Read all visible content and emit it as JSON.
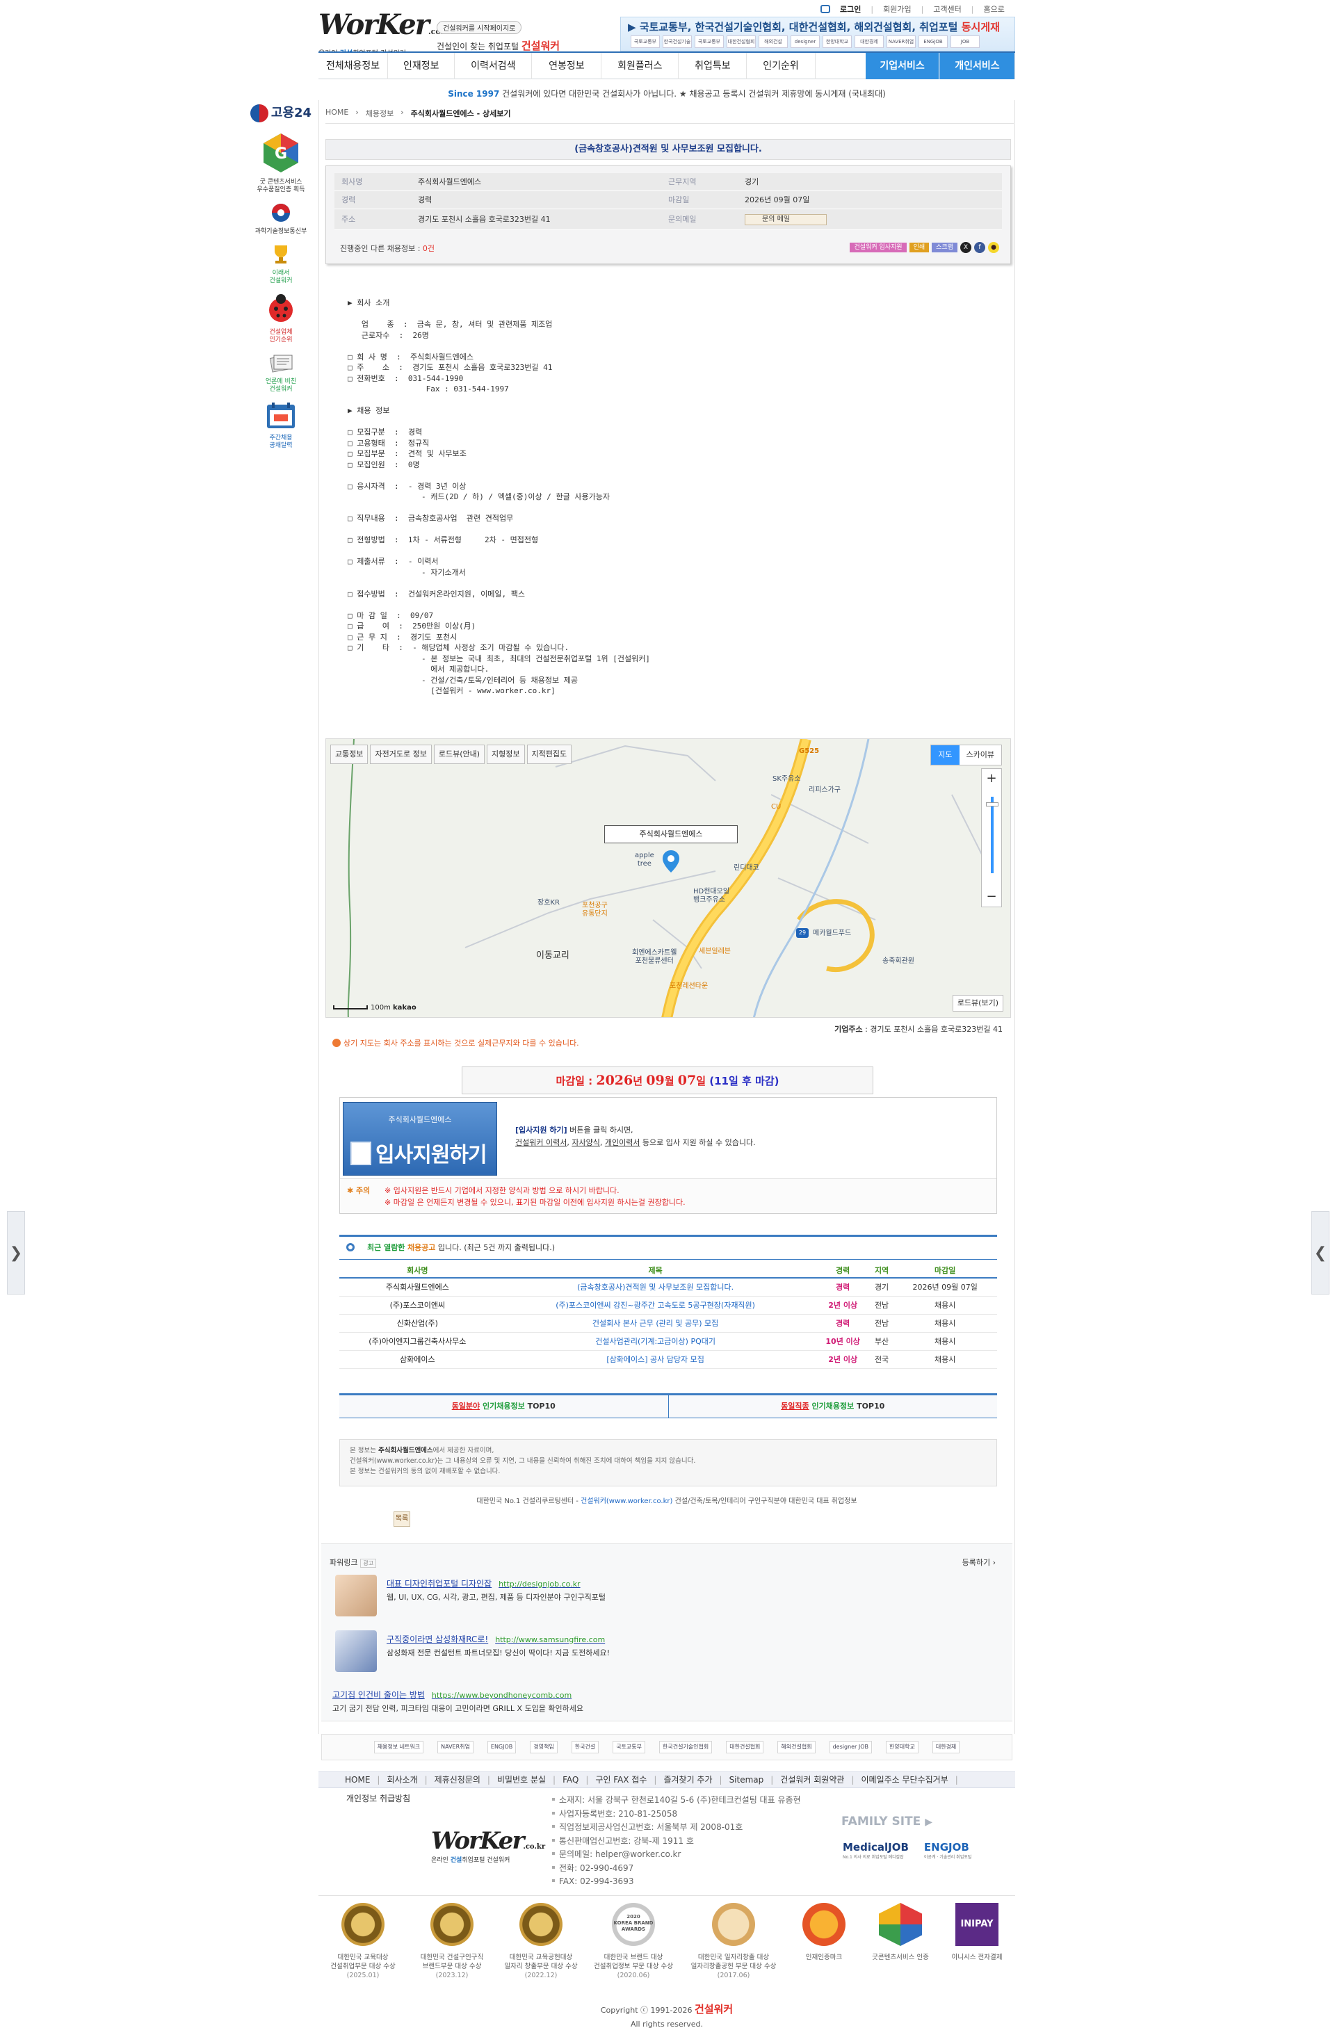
{
  "nav_arrows": {
    "left": "❯",
    "right": "❮"
  },
  "top_links": {
    "login": "로그인",
    "join": "회원가입",
    "support": "고객센터",
    "home": "홈으로"
  },
  "logo": {
    "brand": "WorKer",
    "domain": ".co.kr",
    "tag_pre": "온라인 ",
    "tag_blue": "건설",
    "tag_post": "취업포털 건설워커"
  },
  "slogan": {
    "pill": "건설워커를 시작페이지로",
    "line": "건설인이 찾는 취업포털 ",
    "brand": "건설워커"
  },
  "partner_banner": {
    "text": "국토교통부, 한국건설기술인협회, 대한건설협회, 해외건설협회, 취업포털 ",
    "highlight": "동시게재",
    "logos": [
      "국토교통부",
      "한국건설기술인협회",
      "국토교통부",
      "대한건설협회",
      "해외건설",
      "designer JOB",
      "한양대학교",
      "대한경제",
      "NAVER취업",
      "ENGJOB",
      "JOB"
    ]
  },
  "nav": {
    "items": [
      "전체채용정보",
      "인재정보",
      "이력서검색",
      "연봉정보",
      "회원플러스",
      "취업특보",
      "인기순위"
    ],
    "right_items": [
      "기업서비스",
      "개인서비스"
    ]
  },
  "notice": {
    "since": "Since 1997",
    "text": " 건설워커에 있다면 대한민국 건설회사가 아닙니다. ★ 채용공고 등록시 건설워커 제휴망에 동시게재 (국내최대)"
  },
  "left_bar": {
    "goyong": "고용24",
    "items": [
      {
        "label": "굿 콘텐츠서비스\n우수품질인증 획득",
        "color": ""
      },
      {
        "label": "과학기술정보통신부",
        "color": ""
      },
      {
        "label": "이래서\n건설워커",
        "color": "g"
      },
      {
        "label": "건설업체\n인기순위",
        "color": "r"
      },
      {
        "label": "언론에 비친\n건설워커",
        "color": "g"
      },
      {
        "label": "주간채용\n공채달력",
        "color": "b"
      }
    ]
  },
  "breadcrumb": {
    "home": "HOME",
    "section": "채용정보",
    "current": "주식회사월드엔에스 - 상세보기"
  },
  "job": {
    "title": "(금속창호공사)견적원 및 사무보조원 모집합니다.",
    "company_label": "회사명",
    "company": "주식회사월드엔에스",
    "location_label": "근무지역",
    "location": "경기",
    "career_label": "경력",
    "career": "경력",
    "deadline_label": "마감일",
    "deadline": "2026년 09월 07일",
    "address_label": "주소",
    "address": "경기도 포천시 소흘읍 호국로323번길 41",
    "mail_label": "문의메일",
    "mail_button": "문의 메일",
    "other_jobs_pre": "진행중인 다른 채용정보 : ",
    "other_jobs_count": "0건",
    "share_buttons": [
      "건설워커 입사지원",
      "인쇄",
      "스크랩"
    ],
    "body": "▶ 회사 소개\n\n   업    종  :  금속 문, 창, 셔터 및 관련제품 제조업\n   근로자수  :  26명\n\n□ 회 사 명  :  주식회사월드엔에스\n□ 주    소  :  경기도 포천시 소흘읍 호국로323번길 41\n□ 전화번호  :  031-544-1990\n                 Fax : 031-544-1997\n\n▶ 채용 정보\n\n□ 모집구분  :  경력\n□ 고용형태  :  정규직\n□ 모집부문  :  견적 및 사무보조\n□ 모집인원  :  0명\n\n□ 응시자격  :  - 경력 3년 이상\n                - 캐드(2D / 하) / 엑셀(중)이상 / 한글 사용가능자\n\n□ 직무내용  :  금속창호공사업  관련 견적업무\n\n□ 전형방법  :  1차 - 서류전형     2차 - 면접전형\n\n□ 제출서류  :  - 이력서\n                - 자기소개서\n\n□ 접수방법  :  건설워커온라인지원, 이메일, 팩스\n\n□ 마 감 일  :  09/07\n□ 급    여  :  250만원 이상(月)\n□ 근 무 지  :  경기도 포천시\n□ 기    타  :  - 해당업체 사정상 조기 마감될 수 있습니다.\n                - 본 정보는 국내 최초, 최대의 건설전문취업포털 1위 [건설워커]\n                  에서 제공합니다.\n                - 건설/건축/토목/인테리어 등 채용정보 제공\n                  [건설워커 - www.worker.co.kr]"
  },
  "map": {
    "tabs": [
      "교통정보",
      "자전거도로 정보",
      "로드뷰(안내)",
      "지형정보",
      "지적편집도"
    ],
    "type_on": "지도",
    "type_off": "스카이뷰",
    "zoom_in": "+",
    "zoom_out": "−",
    "marker_label": "주식회사월드엔에스",
    "places": [
      "G525",
      "SK주유소",
      "리피스가구",
      "CU",
      "apple\ntree",
      "린디대코",
      "HD현대오일\n뱅크주유소",
      "장호KR",
      "포천공구\n유통단지",
      "이동교리",
      "회엔에스카트웰\n포천물류센터",
      "세븐일레븐",
      "포천레션타운",
      "메카월드푸드",
      "송죽회관원",
      "29"
    ],
    "scale": "100m",
    "provider": "kakao",
    "roadview": "로드뷰(보기)"
  },
  "company_address": {
    "label": "기업주소",
    "value": " : 경기도 포천시 소흘읍 호국로323번길 41"
  },
  "map_note": "상기 지도는 회사 주소를 표시하는 것으로 실제근무지와 다를 수 있습니다.",
  "deadline_banner": {
    "pre": "마감일 : ",
    "year": "2026",
    "y": "년 ",
    "month": "09",
    "m": "월 ",
    "day": "07",
    "d": "일 ",
    "remain": "(11일 후 마감)"
  },
  "apply": {
    "company": "주식회사월드엔에스",
    "button": "입사지원하기",
    "line1_hl": "[입사지원 하기]",
    "line1": " 버튼을 클릭 하시면,",
    "link1": "건설워커 이력서",
    "link2": "자사양식",
    "link3": "개인이력서",
    "line2_post": " 등으로 입사 지원 하실 수 있습니다.",
    "caution_title": "주의",
    "caution1": "※ 입사지원은 반드시 기업에서 지정한 양식과 방법 으로 하시기 바랍니다.",
    "caution2": "※ 마감일 은 언제든지 변경될 수 있으니, 표기된 마감일 이전에 입사지원 하시는걸 권장합니다."
  },
  "recent": {
    "head_g": "최근 열람한",
    "head_o": "채용공고",
    "head_post": " 입니다.    (최근 5건 까지 출력됩니다.)",
    "columns": [
      "회사명",
      "제목",
      "경력",
      "지역",
      "마감일"
    ],
    "rows": [
      [
        "주식회사월드엔에스",
        "(금속창호공사)견적원 및 사무보조원 모집합니다.",
        "경력",
        "경기",
        "2026년 09월 07일"
      ],
      [
        "(주)포스코이앤씨",
        "(주)포스코이앤씨 강진~광주간 고속도로 5공구현장(자재직원)",
        "2년 이상",
        "전남",
        "채용시"
      ],
      [
        "신화산업(주)",
        "건설회사 본사 근무 (관리 및 공무) 모집",
        "경력",
        "전남",
        "채용시"
      ],
      [
        "(주)아이엔지그룹건축사사무소",
        "건설사업관리(기계:고급이상) PQ대기",
        "10년 이상",
        "부산",
        "채용시"
      ],
      [
        "삼화에이스",
        "[삼화에이스] 공사 담당자 모집",
        "2년 이상",
        "전국",
        "채용시"
      ]
    ]
  },
  "top10": {
    "l_r": "동일분야",
    "l_g": " 인기채용정보",
    "l_post": " TOP10",
    "r_r": "동일직종",
    "r_g": " 인기채용정보",
    "r_post": " TOP10"
  },
  "disclaimer": {
    "l1_pre": "본 정보는 ",
    "l1_b": "주식회사월드엔에스",
    "l1_post": "에서 제공한 자료이며,",
    "l2": "건설워커(www.worker.co.kr)는 그 내용상의 오류 및 지연, 그 내용을 신뢰하여 취해진 조치에 대하여 책임을 지지 않습니다.",
    "l3": "본 정보는 건설워커의 동의 없이 재배포할 수 없습니다."
  },
  "footline": {
    "pre": "대한민국 No.1 건설리쿠르팅센터 - ",
    "link": "건설워커(www.worker.co.kr)",
    "post": " 건설/건축/토목/인테리어 구인구직분야 대한민국 대표 취업정보"
  },
  "list_button": "목록",
  "powerlink": {
    "title": "파워링크",
    "ad_badge": "광고",
    "register": "등록하기 ›",
    "ads": [
      {
        "title": "대표 디자인취업포털 디자인잡",
        "url": "http://designjob.co.kr",
        "desc": "웹, UI, UX, CG, 시각, 광고, 편집, 제품 등 디자인분야 구인구직포털"
      },
      {
        "title": "구직중이라면 삼성화재RC로!",
        "url": "http://www.samsungfire.com",
        "desc": "삼성화재 전문 컨설턴트 파트너모집! 당신이 딱이다! 지금 도전하세요!"
      },
      {
        "title": "고기집 인건비 줄이는 방법",
        "url": "https://www.beyondhoneycomb.com",
        "desc": "고기 굽기 전담 인력, 피크타임 대응이 고민이라면 GRILL X 도입을 확인하세요"
      }
    ]
  },
  "partners": [
    "채용정보 네트워크",
    "NAVER취업",
    "ENGJOB",
    "경영책임",
    "한국건설",
    "국토교통부",
    "한국건설기술인협회",
    "대한건설협회",
    "해외건설협회",
    "designer JOB",
    "한양대학교",
    "대한경제"
  ],
  "footer": {
    "nav": [
      "HOME",
      "회사소개",
      "제휴신청문의",
      "비밀번호 분실",
      "FAQ",
      "구인 FAX 접수",
      "즐겨찾기 추가",
      "Sitemap",
      "건설워커 회원약관",
      "이메일주소 무단수집거부"
    ],
    "privacy": "개인정보 취급방침",
    "info": [
      "소재지: 서울 강북구 한천로140길 5-6 (주)한테크컨설팅 대표 유종현",
      "사업자등록번호: 210-81-25058",
      "직업정보제공사업신고번호: 서울북부 제 2008-01호",
      "통신판매업신고번호: 강북-제 1911 호",
      "문의메일: helper@worker.co.kr",
      "전화: 02-990-4697",
      "FAX: 02-994-3693"
    ],
    "family": "FAMILY SITE",
    "family_logos": [
      {
        "name": "MedicalJOB",
        "sub": "No.1 의사 의료 취업포털 메디칼잡"
      },
      {
        "name": "ENGJOB",
        "sub": "이공계 · 기술관리 취업포털"
      }
    ],
    "awards": [
      {
        "l1": "대한민국 교육대상",
        "l2": "건설취업부문 대상 수상",
        "l3": "(2025.01)"
      },
      {
        "l1": "대한민국 건설구인구직",
        "l2": "브랜드부문 대상 수상",
        "l3": "(2023.12)"
      },
      {
        "l1": "대한민국 교육공헌대상",
        "l2": "일자리 창출부문 대상 수상",
        "l3": "(2022.12)"
      },
      {
        "l1": "대한민국 브랜드 대상",
        "l2": "건설취업정보 부문 대상 수상",
        "l3": "(2020.06)"
      },
      {
        "l1": "대한민국 일자리창출 대상",
        "l2": "일자리창출공헌 부문 대상 수상",
        "l3": "(2017.06)"
      },
      {
        "l1": "인재인증마크",
        "l2": "",
        "l3": ""
      },
      {
        "l1": "굿콘텐츠서비스 인증",
        "l2": "",
        "l3": ""
      },
      {
        "l1": "이니시스 전자결제",
        "l2": "",
        "l3": ""
      }
    ],
    "award_badges": {
      "a4": "2020\nKOREA BRAND\nAWARDS",
      "a8": "INIPAY"
    },
    "copyright_pre": "Copyright ⓒ 1991-2026 ",
    "copyright_brand": "건설워커",
    "reserved": "All rights reserved."
  },
  "colors": {
    "brand_blue": "#2f8fe0",
    "accent_red": "#e2342d",
    "link_blue": "#1c66c4",
    "green": "#1f9d3b"
  }
}
